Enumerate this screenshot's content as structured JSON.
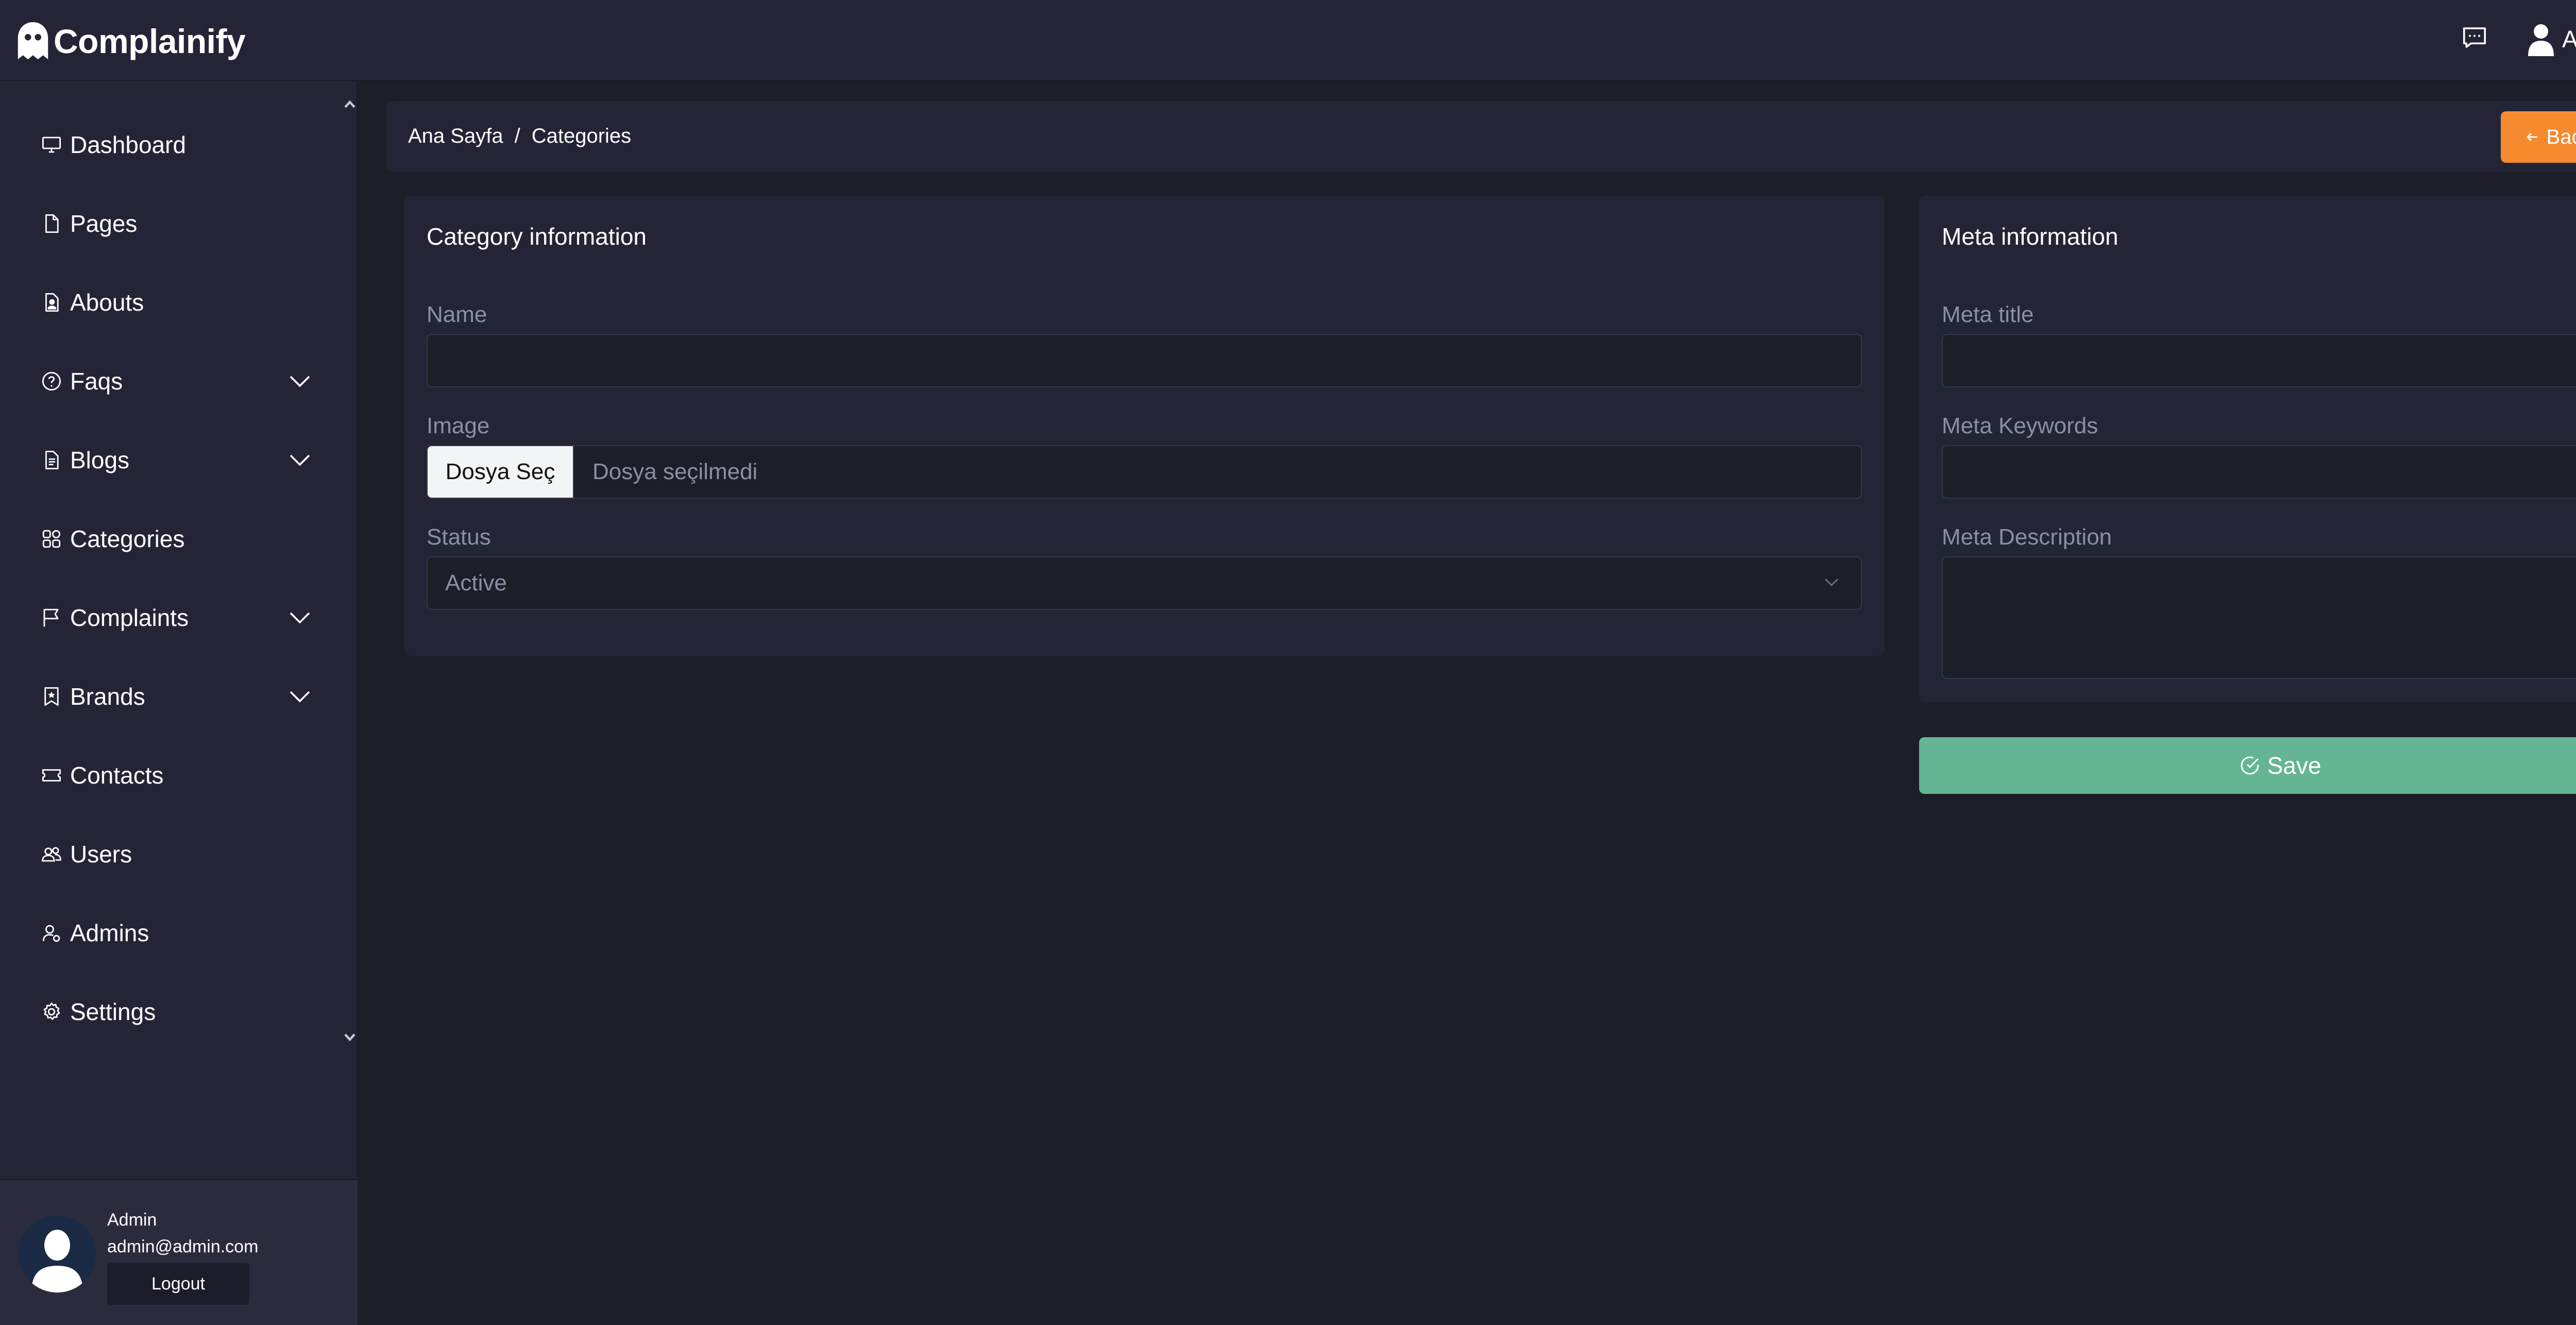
{
  "app": {
    "brand_name": "Complainify",
    "brand_icon": "ghost-icon",
    "accent_color": "#f68a2f",
    "success_color": "#64b593"
  },
  "header": {
    "chat_icon": "chat-icon",
    "user_label": "Admin"
  },
  "sidebar": {
    "items": [
      {
        "label": "Dashboard",
        "icon": "monitor-icon",
        "expandable": false
      },
      {
        "label": "Pages",
        "icon": "page-icon",
        "expandable": false
      },
      {
        "label": "Abouts",
        "icon": "id-badge-icon",
        "expandable": false
      },
      {
        "label": "Faqs",
        "icon": "question-circle-icon",
        "expandable": true
      },
      {
        "label": "Blogs",
        "icon": "document-icon",
        "expandable": true
      },
      {
        "label": "Categories",
        "icon": "grid-icon",
        "expandable": false
      },
      {
        "label": "Complaints",
        "icon": "flag-icon",
        "expandable": true
      },
      {
        "label": "Brands",
        "icon": "bookmark-icon",
        "expandable": true
      },
      {
        "label": "Contacts",
        "icon": "ticket-icon",
        "expandable": false
      },
      {
        "label": "Users",
        "icon": "users-icon",
        "expandable": false
      },
      {
        "label": "Admins",
        "icon": "user-gear-icon",
        "expandable": false
      },
      {
        "label": "Settings",
        "icon": "gear-icon",
        "expandable": false
      }
    ],
    "footer": {
      "name": "Admin",
      "email": "admin@admin.com",
      "logout_label": "Logout"
    }
  },
  "breadcrumb": {
    "home": "Ana Sayfa",
    "separator": "/",
    "current": "Categories",
    "back_label": "Back"
  },
  "category_card": {
    "title": "Category information",
    "name_label": "Name",
    "name_value": "",
    "image_label": "Image",
    "file_button": "Dosya Seç",
    "file_status": "Dosya seçilmedi",
    "status_label": "Status",
    "status_value": "Active"
  },
  "meta_card": {
    "title": "Meta information",
    "meta_title_label": "Meta title",
    "meta_title_value": "",
    "meta_keywords_label": "Meta Keywords",
    "meta_keywords_value": "",
    "meta_description_label": "Meta Description"
  },
  "save_label": "Save"
}
